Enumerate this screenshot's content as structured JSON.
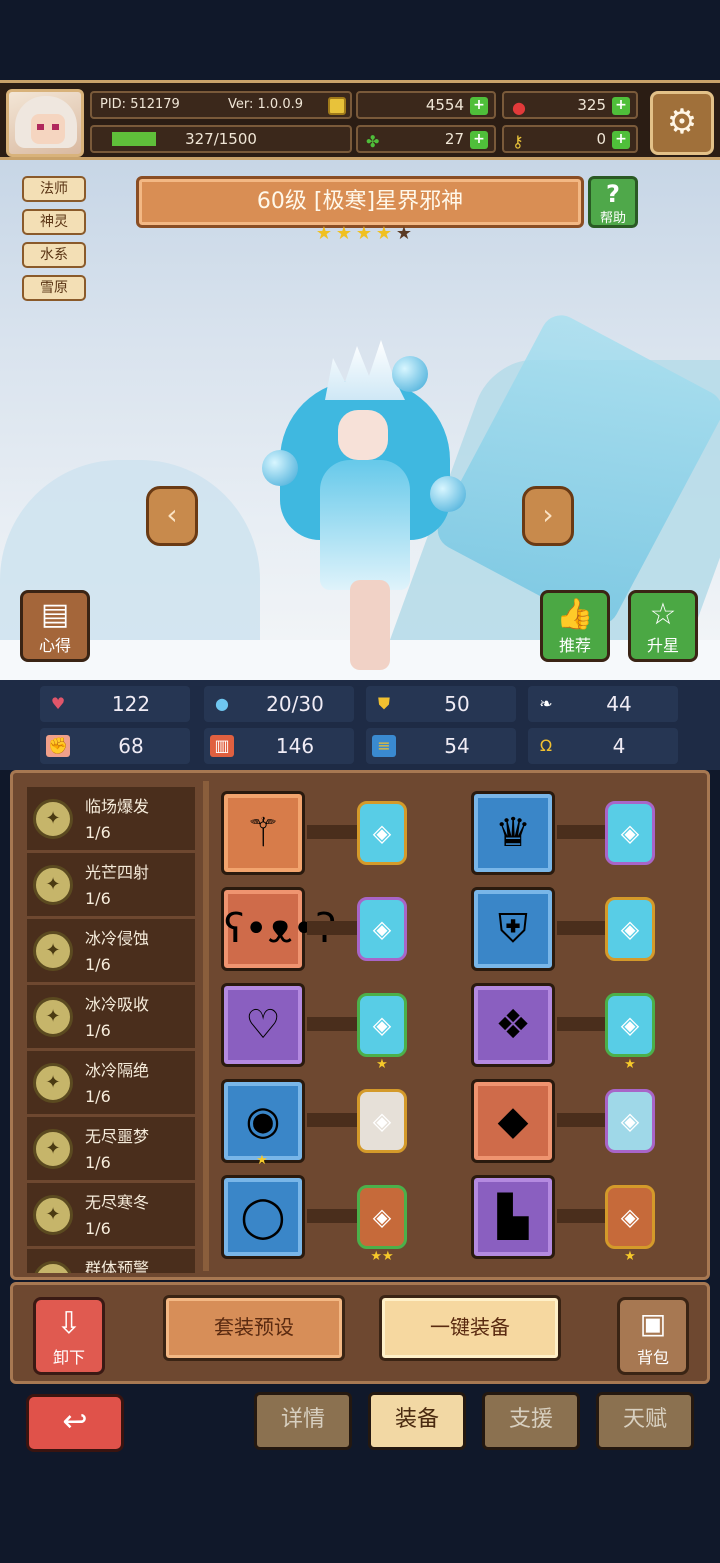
{
  "header": {
    "pid": "PID: 512179",
    "version": "Ver: 1.0.0.9",
    "gold": "4554",
    "gems": "325",
    "exp": "327/1500",
    "exp_fraction": 0.218,
    "clover": "27",
    "keys": "0",
    "plus_symbol": "+",
    "settings_icon": "gear-icon"
  },
  "hero": {
    "tags": [
      "法师",
      "神灵",
      "水系",
      "雪原"
    ],
    "title": "60级 [极寒]星界邪神",
    "stars_filled": 4,
    "stars_total": 5,
    "help_label": "帮助",
    "help_glyph": "?"
  },
  "scene_buttons": {
    "xinde": "心得",
    "tuijian": "推荐",
    "shengxing": "升星"
  },
  "stats": [
    {
      "icon": "heart-icon",
      "value": "122",
      "color": "#e0566a"
    },
    {
      "icon": "water-drop-icon",
      "value": "20/30",
      "color": "#6fc6ef"
    },
    {
      "icon": "shield-icon",
      "value": "50",
      "color": "#f0c030"
    },
    {
      "icon": "wing-icon",
      "value": "44",
      "color": "#ffffff"
    },
    {
      "icon": "fist-icon",
      "value": "68",
      "color": "#f0a08a"
    },
    {
      "icon": "spellbook-icon",
      "value": "146",
      "color": "#e06040"
    },
    {
      "icon": "dash-icon",
      "value": "54",
      "color": "#3a8ad0"
    },
    {
      "icon": "horseshoe-icon",
      "value": "4",
      "color": "#f0c030"
    }
  ],
  "skills": [
    {
      "name": "临场爆发",
      "count": "1/6"
    },
    {
      "name": "光芒四射",
      "count": "1/6"
    },
    {
      "name": "冰冷侵蚀",
      "count": "1/6"
    },
    {
      "name": "冰冷吸收",
      "count": "1/6"
    },
    {
      "name": "冰冷隔绝",
      "count": "1/6"
    },
    {
      "name": "无尽噩梦",
      "count": "1/6"
    },
    {
      "name": "无尽寒冬",
      "count": "1/6"
    },
    {
      "name": "群体预警",
      "count": ""
    }
  ],
  "actions": {
    "unequip": "卸下",
    "preset": "套装预设",
    "oneclick": "一键装备",
    "bag": "背包"
  },
  "tabs": [
    "详情",
    "装备",
    "支援",
    "天赋"
  ],
  "active_tab": "装备",
  "colors": {
    "gold": "#e8c23a",
    "green": "#4fbf3a",
    "panel": "#6e4830",
    "navy": "#1e2b45"
  }
}
